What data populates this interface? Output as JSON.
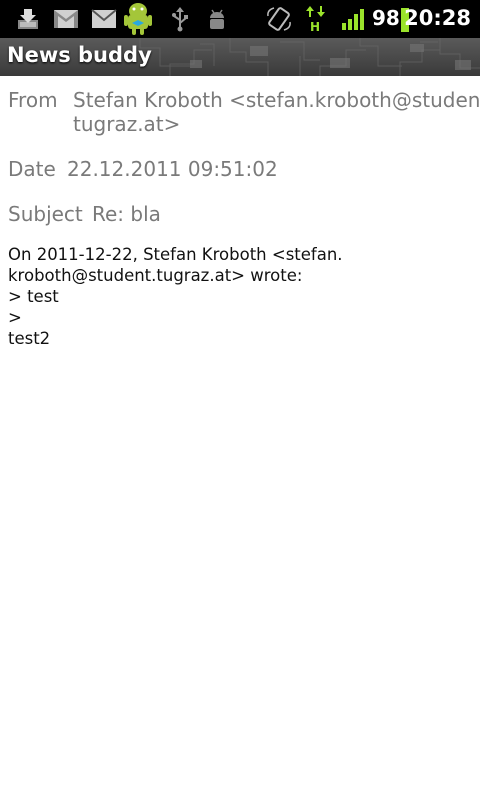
{
  "status_bar": {
    "icons": [
      "download-icon",
      "gmail-icon",
      "email-icon",
      "android-buddy-icon",
      "usb-icon",
      "android-debug-icon",
      "rotate-icon",
      "hspa-data-icon",
      "signal-icon",
      "battery-icon"
    ],
    "battery_percent": "98",
    "time": "20:28",
    "accent_color": "#9be32b"
  },
  "app_bar": {
    "title": "News buddy"
  },
  "message": {
    "from_label": "From",
    "from_line1": "Stefan Kroboth <stefan.kroboth@student.",
    "from_line2": "tugraz.at>",
    "date_label": "Date",
    "date_value": "22.12.2011 09:51:02",
    "subject_label": "Subject",
    "subject_value": "Re: bla",
    "body_lines": [
      "On 2011-12-22, Stefan Kroboth <stefan.",
      "kroboth@student.tugraz.at> wrote:",
      "> test",
      ">",
      "test2"
    ]
  }
}
